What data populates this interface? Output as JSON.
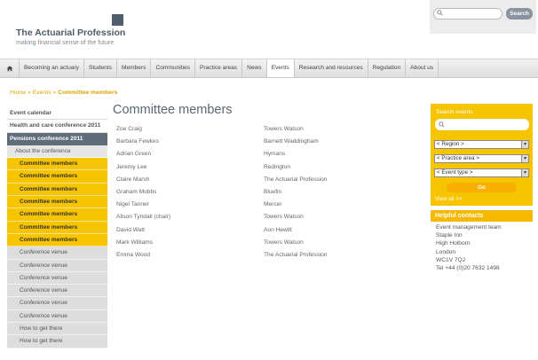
{
  "brand": {
    "title": "The Actuarial Profession",
    "tagline": "making financial sense of the future"
  },
  "search": {
    "placeholder": "",
    "button": "Search"
  },
  "nav": {
    "home_icon": "home-icon",
    "items": [
      "Becoming an actuary",
      "Students",
      "Members",
      "Communities",
      "Practice areas",
      "News",
      "Events",
      "Research and resources",
      "Regulation",
      "About us"
    ],
    "active": "Events"
  },
  "breadcrumb": {
    "home": "Home",
    "events": "Events",
    "current": "Committee members",
    "separator": "»"
  },
  "sidebar": {
    "top": [
      "Event calendar",
      "Health and care conference 2011",
      "Pensions conference 2011"
    ],
    "sub": "About the conference",
    "yellow": [
      "Committee members",
      "Committee members",
      "Committee members",
      "Committee members",
      "Committee members",
      "Committee members",
      "Committee members"
    ],
    "grey": [
      "Conference venue",
      "Conference venue",
      "Conference venue",
      "Conference venue",
      "Conference venue",
      "Conference venue",
      "How to get there",
      "How to get there"
    ]
  },
  "main": {
    "title": "Committee members",
    "members": [
      {
        "name": "Zoe Craig",
        "org": "Towers Watson"
      },
      {
        "name": "Barbara Fewkes",
        "org": "Barnett Waddingham"
      },
      {
        "name": "Adrian Green",
        "org": "Hymans"
      },
      {
        "name": "Jeremy Lee",
        "org": "Redington"
      },
      {
        "name": "Claire Marsh",
        "org": "The Actuarial Profession"
      },
      {
        "name": "Graham Mobbs",
        "org": "Bluefin"
      },
      {
        "name": "Nigel Tanner",
        "org": "Mercer"
      },
      {
        "name": "Alison Tyndall (chair)",
        "org": "Towers Watson"
      },
      {
        "name": "David Watt",
        "org": "Aon Hewitt"
      },
      {
        "name": "Mark Williams",
        "org": "Towers Watson"
      },
      {
        "name": "Emma Wood",
        "org": "The Actuarial Profession"
      }
    ]
  },
  "events_panel": {
    "title": "Search events",
    "region": "< Region >",
    "practice_area": "< Practice area >",
    "event_type": "< Event type >",
    "go": "Go",
    "view_all": "View all >>"
  },
  "contacts": {
    "heading": "Helpful contacts",
    "lines": [
      "Event management team",
      "Staple Inn",
      "High Holborn",
      "London",
      "WC1V 7QJ",
      "Tel +44 (0)20 7632 1498"
    ]
  },
  "colors": {
    "accent_yellow": "#f6c400",
    "slate": "#5f6d7a",
    "breadcrumb": "#d9a400"
  }
}
